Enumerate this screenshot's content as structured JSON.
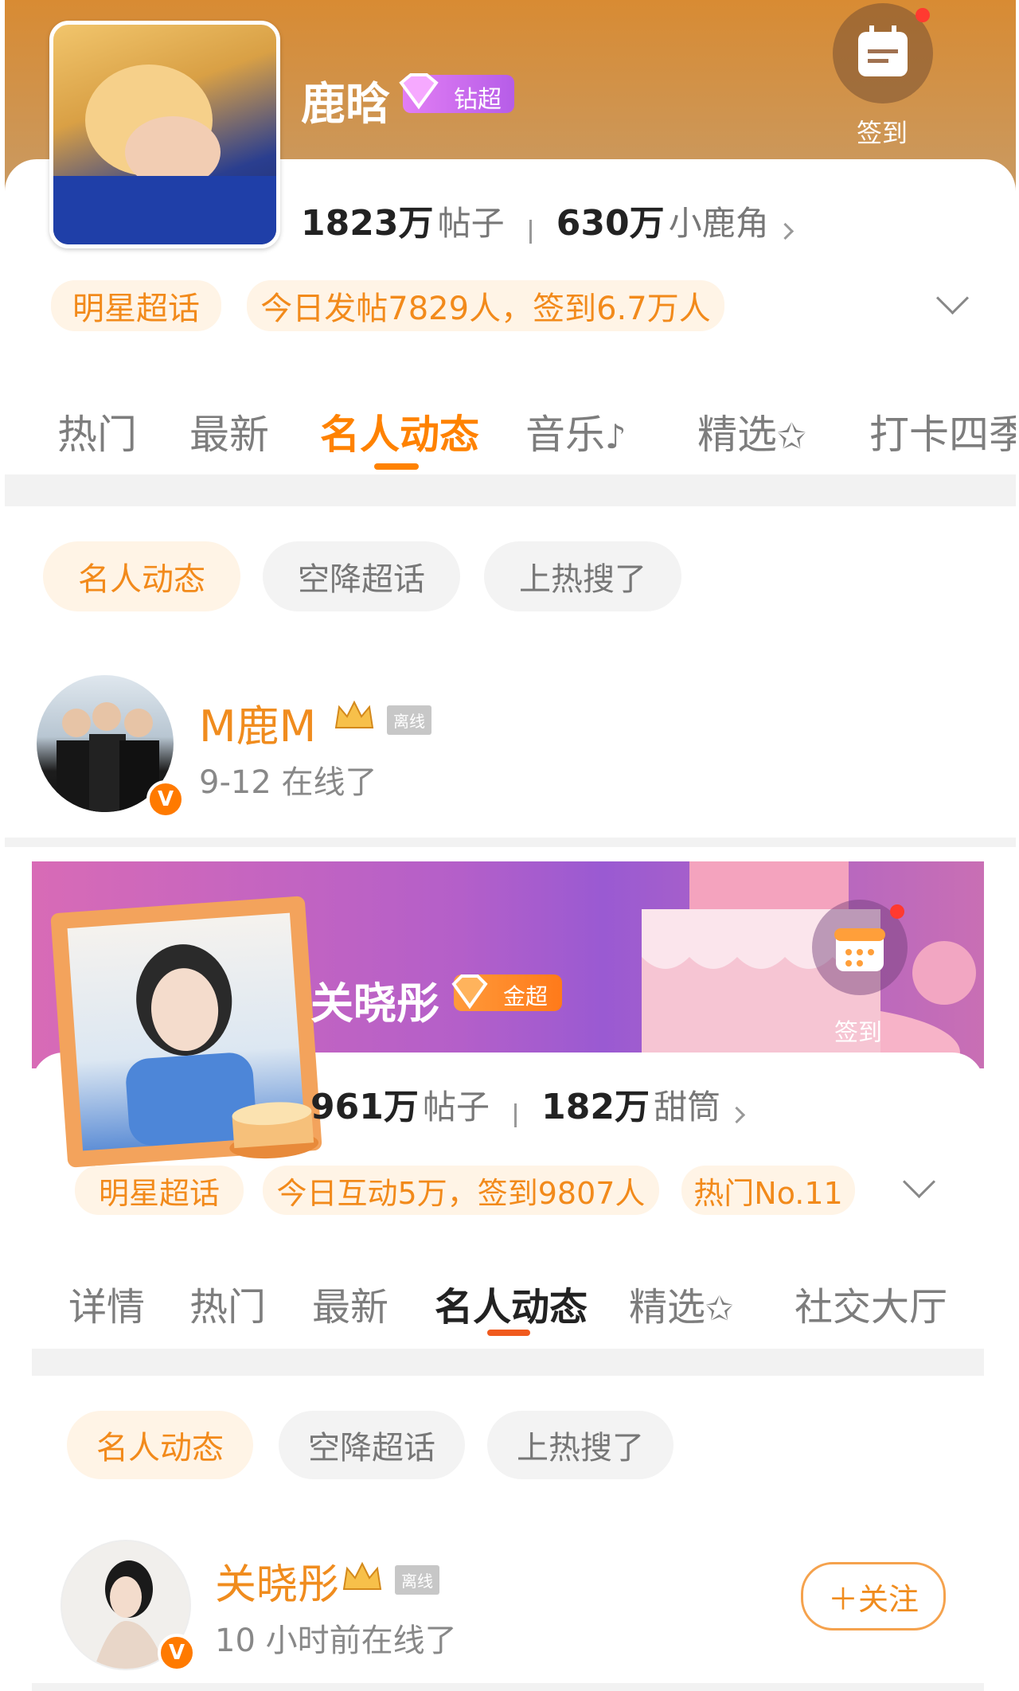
{
  "card1": {
    "name": "鹿晗",
    "level_badge": "钻超",
    "checkin_label": "签到",
    "posts_count": "1823万",
    "posts_label": "帖子",
    "fans_count": "630万",
    "fans_label": "小鹿角",
    "pills": [
      "明星超话",
      "今日发帖7829人，签到6.7万人"
    ],
    "tabs": [
      "热门",
      "最新",
      "名人动态",
      "音乐",
      "精选",
      "打卡四季"
    ],
    "active_tab": "名人动态",
    "filters": [
      "名人动态",
      "空降超话",
      "上热搜了"
    ],
    "celebrity": {
      "name": "M鹿M",
      "status_badge": "离线",
      "online_text": "9-12 在线了",
      "verified": "V"
    },
    "colors": {
      "header_top": "#d98e3a",
      "accent": "#ff8200"
    }
  },
  "card2": {
    "name": "关晓彤",
    "level_badge": "金超",
    "checkin_label": "签到",
    "posts_count": "961万",
    "posts_label": "帖子",
    "fans_count": "182万",
    "fans_label": "甜筒",
    "pills": [
      "明星超话",
      "今日互动5万，签到9807人",
      "热门No.11"
    ],
    "tabs": [
      "详情",
      "热门",
      "最新",
      "名人动态",
      "精选",
      "社交大厅"
    ],
    "active_tab": "名人动态",
    "filters": [
      "名人动态",
      "空降超话",
      "上热搜了"
    ],
    "celebrity": {
      "name": "关晓彤",
      "status_badge": "离线",
      "online_text": "10 小时前在线了",
      "verified": "V",
      "follow_label": "＋关注"
    },
    "colors": {
      "header": "#c764b0",
      "accent": "#ff8200"
    }
  }
}
